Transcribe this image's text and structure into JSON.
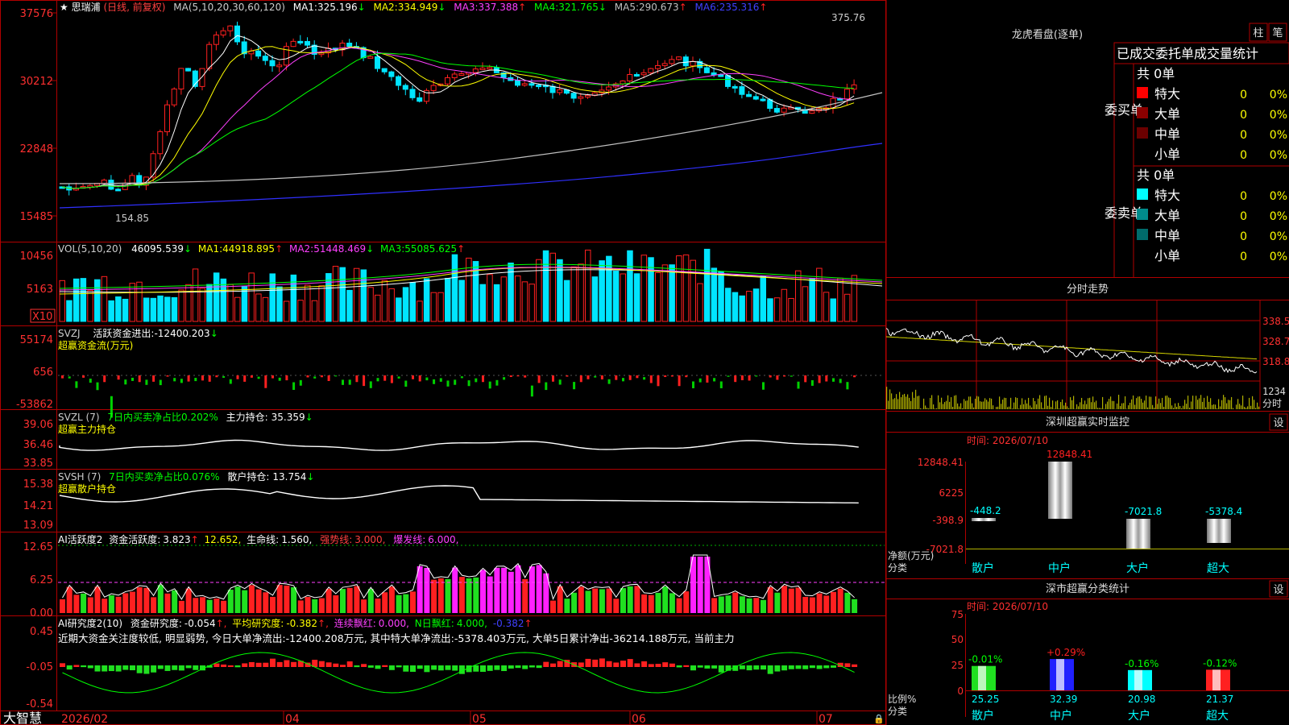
{
  "stock": {
    "name": "思瑞浦",
    "mode": "(日线, 前复权)"
  },
  "colors": {
    "up": "#ff2020",
    "down": "#00e5ff",
    "ma1": "#ffffff",
    "ma2": "#ffff00",
    "ma3": "#ff40ff",
    "ma4": "#00ff00",
    "ma5": "#c0c0c0",
    "ma6": "#3030ff",
    "panel": "#b00000"
  },
  "kline": {
    "ma_label": "MA(5,10,20,30,60,120)",
    "ma": [
      {
        "name": "MA1:",
        "val": "325.196",
        "arrow": "↓"
      },
      {
        "name": "MA2:",
        "val": "334.949",
        "arrow": "↓"
      },
      {
        "name": "MA3:",
        "val": "337.388",
        "arrow": "↑"
      },
      {
        "name": "MA4:",
        "val": "321.765",
        "arrow": "↓"
      },
      {
        "name": "MA5:",
        "val": "290.673",
        "arrow": "↑"
      },
      {
        "name": "MA6:",
        "val": "235.316",
        "arrow": "↑"
      }
    ],
    "y_ticks": [
      "37576",
      "30212",
      "22848",
      "15485"
    ],
    "high_label": "375.76",
    "low_label": "154.85"
  },
  "vol": {
    "label": "VOL(5,10,20)",
    "val": "46095.539",
    "arrow": "↓",
    "ma": [
      {
        "name": "MA1:",
        "val": "44918.895",
        "arrow": "↑"
      },
      {
        "name": "MA2:",
        "val": "51448.469",
        "arrow": "↓"
      },
      {
        "name": "MA3:",
        "val": "55085.625",
        "arrow": "↑"
      }
    ],
    "y_ticks": [
      "10456",
      "5163"
    ],
    "unit": "X10"
  },
  "svzj": {
    "label": "SVZJ",
    "title": "活跃资金进出:",
    "val": "-12400.203",
    "arrow": "↓",
    "sub": "超赢资金流(万元)",
    "y_ticks": [
      "55174",
      "656",
      "-53862"
    ]
  },
  "svzl": {
    "label": "SVZL (7)",
    "text1": "7日内买卖净占比0.202%",
    "text2": "主力持仓:",
    "val": "35.359",
    "arrow": "↓",
    "sub": "超赢主力持仓",
    "y_ticks": [
      "39.06",
      "36.46",
      "33.85"
    ]
  },
  "svsh": {
    "label": "SVSH (7)",
    "text1": "7日内买卖净占比0.076%",
    "text2": "散户持仓:",
    "val": "13.754",
    "arrow": "↓",
    "sub": "超赢散户持仓",
    "y_ticks": [
      "15.38",
      "14.21",
      "13.09"
    ]
  },
  "ai1": {
    "label": "AI活跃度2",
    "t1": "资金活跃度:",
    "v1": "3.823",
    "t2": "12.652,",
    "t3": "生命线:",
    "v3": "1.560,",
    "t4": "强势线:",
    "v4": "3.000,",
    "t5": "爆发线:",
    "v5": "6.000,",
    "y_ticks": [
      "12.65",
      "6.25",
      "0.00"
    ]
  },
  "ai2": {
    "label": "AI研究度2(10)",
    "t1": "资金研究度:",
    "v1": "-0.054",
    "t2": "平均研究度:",
    "v2": "-0.382",
    "t3": "连续飘红:",
    "v3": "0.000,",
    "t4": "N日飘红:",
    "v4": "4.000,",
    "v5": "-0.382",
    "y_ticks": [
      "0.45",
      "-0.05",
      "-0.54"
    ],
    "comment": "近期大资金关注度较低, 明显弱势, 今日大单净流出:-12400.208万元, 其中特大单净流出:-5378.403万元, 大单5日累计净出-36214.188万元, 当前主力"
  },
  "bottom": {
    "brand": "大智慧",
    "dates": [
      "2026/02",
      "04",
      "05",
      "06",
      "07"
    ]
  },
  "lhb": {
    "title": "龙虎看盘(逐单)",
    "btn1": "柱",
    "btn2": "笔",
    "tabs": "已成交委托单成交量统计",
    "buy": {
      "side": "委买单",
      "total": "共 0单",
      "rows": [
        {
          "name": "特大",
          "n": "0",
          "p": "0%",
          "c": "#ff0000"
        },
        {
          "name": "大单",
          "n": "0",
          "p": "0%",
          "c": "#8b0000"
        },
        {
          "name": "中单",
          "n": "0",
          "p": "0%",
          "c": "#6b0000"
        },
        {
          "name": "小单",
          "n": "0",
          "p": "0%",
          "c": "#000"
        }
      ]
    },
    "sell": {
      "side": "委卖单",
      "total": "共 0单",
      "rows": [
        {
          "name": "特大",
          "n": "0",
          "p": "0%",
          "c": "#00ffff"
        },
        {
          "name": "大单",
          "n": "0",
          "p": "0%",
          "c": "#008b8b"
        },
        {
          "name": "中单",
          "n": "0",
          "p": "0%",
          "c": "#006b6b"
        },
        {
          "name": "小单",
          "n": "0",
          "p": "0%",
          "c": "#000"
        }
      ]
    }
  },
  "fenshi": {
    "title": "分时走势",
    "y_ticks": [
      "338.5",
      "328.7",
      "318.8"
    ],
    "vol_tick": "1234",
    "unit": "分时"
  },
  "monitor": {
    "title": "深圳超赢实时监控",
    "btn": "设",
    "time": "时间: 2026/07/10",
    "y_ticks": [
      "12848.41",
      "6225",
      "-398.9",
      "-7021.8"
    ],
    "ylabel": "净额(万元)",
    "xlabel": "分类",
    "bars": [
      {
        "cat": "散户",
        "val": "-448.2"
      },
      {
        "cat": "中户",
        "val": "12848.41"
      },
      {
        "cat": "大户",
        "val": "-7021.8"
      },
      {
        "cat": "超大",
        "val": "-5378.4"
      }
    ]
  },
  "stats": {
    "title": "深市超赢分类统计",
    "btn": "设",
    "time": "时间: 2026/07/10",
    "y_ticks": [
      "75",
      "50",
      "25",
      "0"
    ],
    "ylabel": "比例%",
    "xlabel": "分类",
    "bars": [
      {
        "cat": "散户",
        "pct": "25.25",
        "chg": "-0.01%"
      },
      {
        "cat": "中户",
        "pct": "32.39",
        "chg": "+0.29%"
      },
      {
        "cat": "大户",
        "pct": "20.98",
        "chg": "-0.16%"
      },
      {
        "cat": "超大",
        "pct": "21.37",
        "chg": "-0.12%"
      }
    ]
  }
}
